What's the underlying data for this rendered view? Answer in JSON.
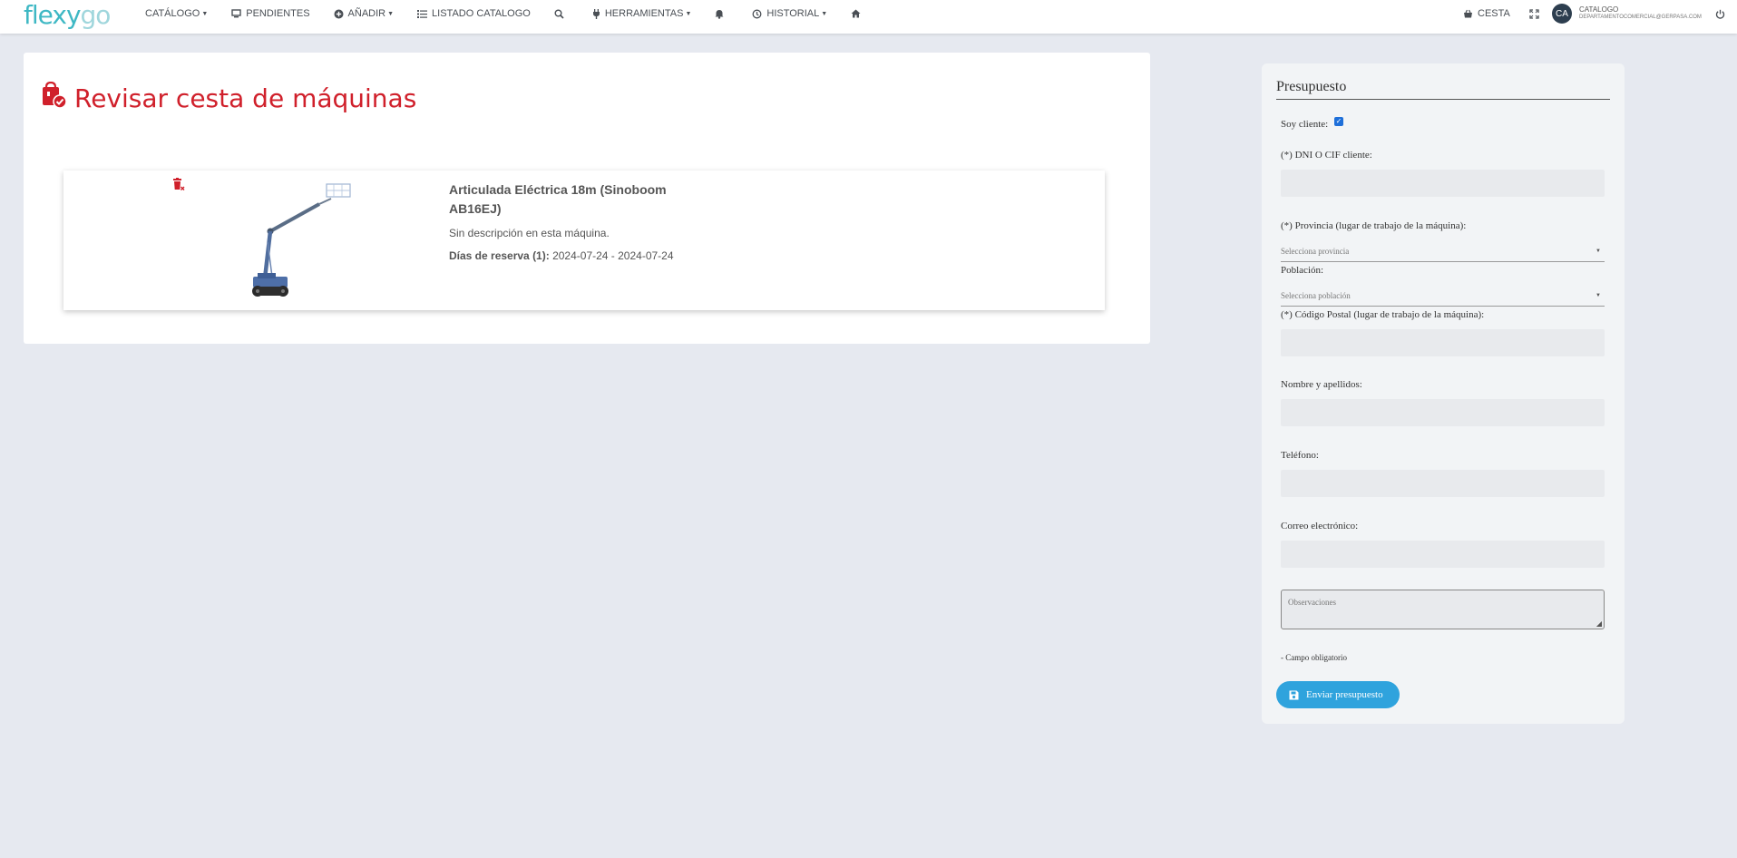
{
  "app": {
    "logo_part1": "flexy",
    "logo_part2": "go"
  },
  "nav": {
    "items": [
      {
        "label": "CATÁLOGO",
        "icon": "none",
        "dropdown": true
      },
      {
        "label": "PENDIENTES",
        "icon": "monitor-icon",
        "dropdown": false
      },
      {
        "label": "AÑADIR",
        "icon": "plus-circle-icon",
        "dropdown": true
      },
      {
        "label": "LISTADO CATALOGO",
        "icon": "list-icon",
        "dropdown": false
      },
      {
        "label": "",
        "icon": "search-icon",
        "dropdown": false
      },
      {
        "label": "HERRAMIENTAS",
        "icon": "plug-icon",
        "dropdown": true
      },
      {
        "label": "",
        "icon": "bell-icon",
        "dropdown": false
      },
      {
        "label": "HISTORIAL",
        "icon": "history-icon",
        "dropdown": true
      },
      {
        "label": "",
        "icon": "home-icon",
        "dropdown": false
      }
    ],
    "cart_label": "CESTA",
    "avatar_initials": "CA",
    "user_name": "CATALOGO",
    "user_email": "DEPARTAMENTOCOMERCIAL@GERPASA.COM"
  },
  "main": {
    "title": "Revisar cesta de máquinas",
    "item": {
      "name": "Articulada Eléctrica 18m (Sinoboom AB16EJ)",
      "description": "Sin descripción en esta máquina.",
      "days_label": "Días de reserva (1):",
      "days_value": "2024-07-24 - 2024-07-24"
    }
  },
  "form": {
    "title": "Presupuesto",
    "soy_cliente_label": "Soy cliente:",
    "soy_cliente_checked": true,
    "dni_label": "(*) DNI O CIF cliente:",
    "provincia_label": "(*) Provincia (lugar de trabajo de la máquina):",
    "provincia_placeholder": "Selecciona provincia",
    "poblacion_label": "Población:",
    "poblacion_placeholder": "Selecciona población",
    "cp_label": "(*) Código Postal (lugar de trabajo de la máquina):",
    "nombre_label": "Nombre y apellidos:",
    "telefono_label": "Teléfono:",
    "correo_label": "Correo electrónico:",
    "observaciones_placeholder": "Observaciones",
    "note": "- Campo obligatorio",
    "send_label": "Enviar presupuesto"
  },
  "colors": {
    "accent": "#d0202b",
    "button": "#2fa3dd",
    "logo": "#3eb8c4"
  }
}
